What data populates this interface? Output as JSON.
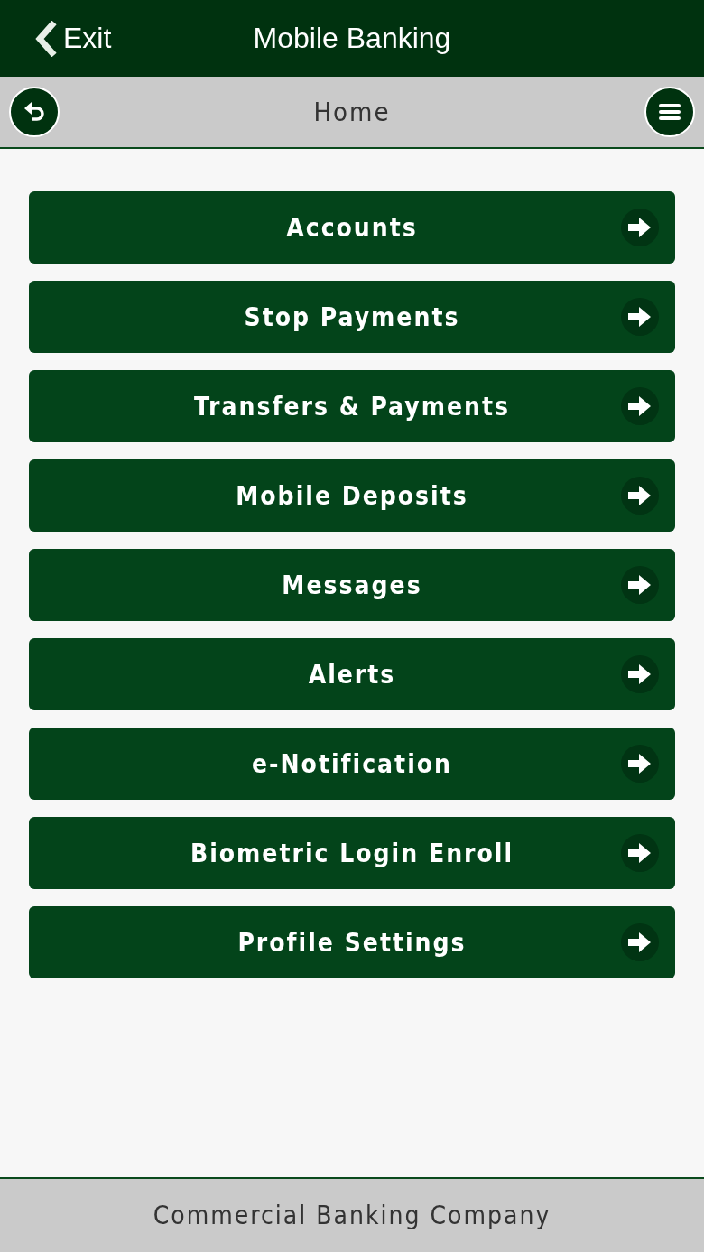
{
  "header": {
    "exit_label": "Exit",
    "title": "Mobile Banking"
  },
  "nav": {
    "title": "Home"
  },
  "menu": [
    {
      "label": "Accounts"
    },
    {
      "label": "Stop Payments"
    },
    {
      "label": "Transfers & Payments"
    },
    {
      "label": "Mobile Deposits"
    },
    {
      "label": "Messages"
    },
    {
      "label": "Alerts"
    },
    {
      "label": "e-Notification"
    },
    {
      "label": "Biometric Login Enroll"
    },
    {
      "label": "Profile Settings"
    }
  ],
  "footer": {
    "text": "Commercial Banking Company"
  }
}
